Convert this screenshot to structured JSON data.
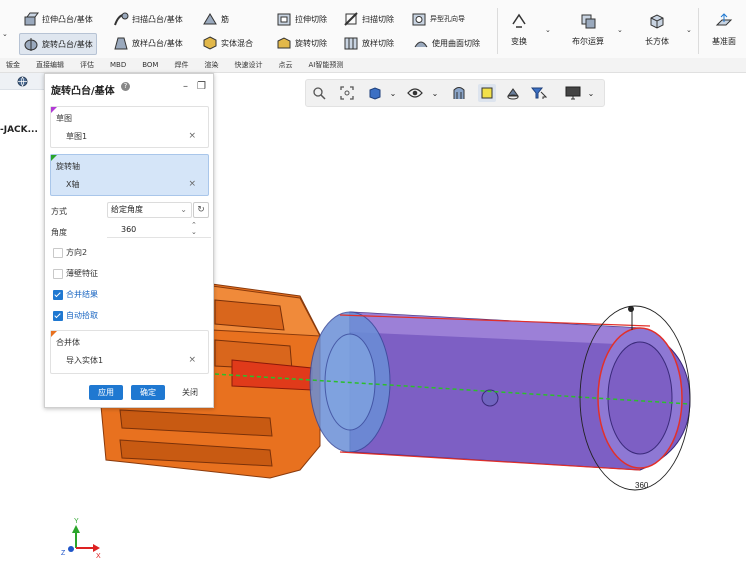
{
  "ribbon": {
    "row1": {
      "extrude_boss": "拉伸凸台/基体",
      "sweep_boss": "扫描凸台/基体",
      "rib": "筋",
      "extrude_cut": "拉伸切除",
      "sweep_cut": "扫描切除",
      "hole_wizard": "异型孔向导"
    },
    "row2": {
      "revolve_boss": "旋转凸台/基体",
      "loft_boss": "放样凸台/基体",
      "solid_mix": "实体混合",
      "revolve_cut": "旋转切除",
      "loft_cut": "放样切除",
      "surface_cut": "使用曲面切除"
    },
    "big": {
      "transform": "变换",
      "boolean": "布尔运算",
      "box": "长方体",
      "datum_plane": "基准面"
    }
  },
  "menubar": [
    "钣金",
    "直接编辑",
    "评估",
    "MBD",
    "BOM",
    "焊件",
    "渲染",
    "快速设计",
    "点云",
    "AI智能预测"
  ],
  "left_tree": {
    "item": "-JACK..."
  },
  "panel": {
    "title": "旋转凸台/基体",
    "sketch": {
      "label": "草图",
      "value": "草图1"
    },
    "axis": {
      "label": "旋转轴",
      "value": "X轴"
    },
    "method": {
      "label": "方式",
      "value": "给定角度"
    },
    "angle": {
      "label": "角度",
      "value": "360"
    },
    "direction2": "方向2",
    "thin": "薄壁特征",
    "merge_result": "合并结果",
    "auto_pick": "自动拾取",
    "merge_body": {
      "label": "合并体",
      "value": "导入实体1"
    },
    "apply": "应用",
    "ok": "确定",
    "close": "关闭"
  },
  "viewport": {
    "dim_label": "360",
    "axis_y": "Y",
    "axis_z": "Z",
    "axis_x": "X"
  }
}
